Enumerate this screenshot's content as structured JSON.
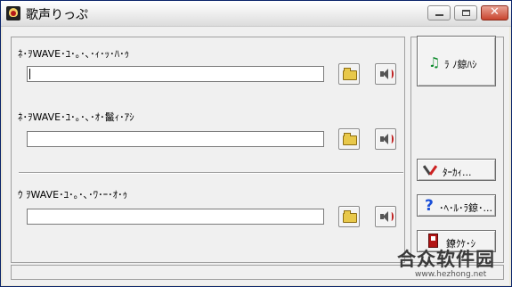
{
  "window": {
    "title": "歌声りっぷ"
  },
  "titlebar_buttons": {
    "minimize": "",
    "maximize": "",
    "close": "✕"
  },
  "sections": [
    {
      "label": "ﾈ･ｦWAVE･ﾕ･｡･､･ｨ･ｯ･ﾊ･ｩ",
      "value": ""
    },
    {
      "label": "ﾈ･ｦWAVE･ﾕ･｡･､･ｵ･鬣ｨ･ｱｼ",
      "value": ""
    },
    {
      "label": "ｳ ｦWAVE･ﾕ･｡･､･ﾜ･ｰ･ｵ･ｩ",
      "value": ""
    }
  ],
  "right_buttons": {
    "start": "ﾗ ﾉ鍄ﾊｼ",
    "settings": "ﾀｰｶｨ...",
    "help": "･ﾍ･ﾙ･ﾗ鍄･...",
    "exit": "鐐ｸｹ･ｼ"
  },
  "watermark": {
    "main": "合众软件园",
    "sub": "www.hezhong.net"
  },
  "icons": {
    "app": "app-icon",
    "browse": "folder-open-icon",
    "play": "speaker-icon",
    "start": "music-note-icon",
    "settings": "tools-icon",
    "help": "question-mark-icon",
    "exit": "exit-door-icon"
  },
  "colors": {
    "accent_green": "#0a8a2a",
    "help_blue": "#1a4fd8",
    "close_red": "#c9452f"
  }
}
